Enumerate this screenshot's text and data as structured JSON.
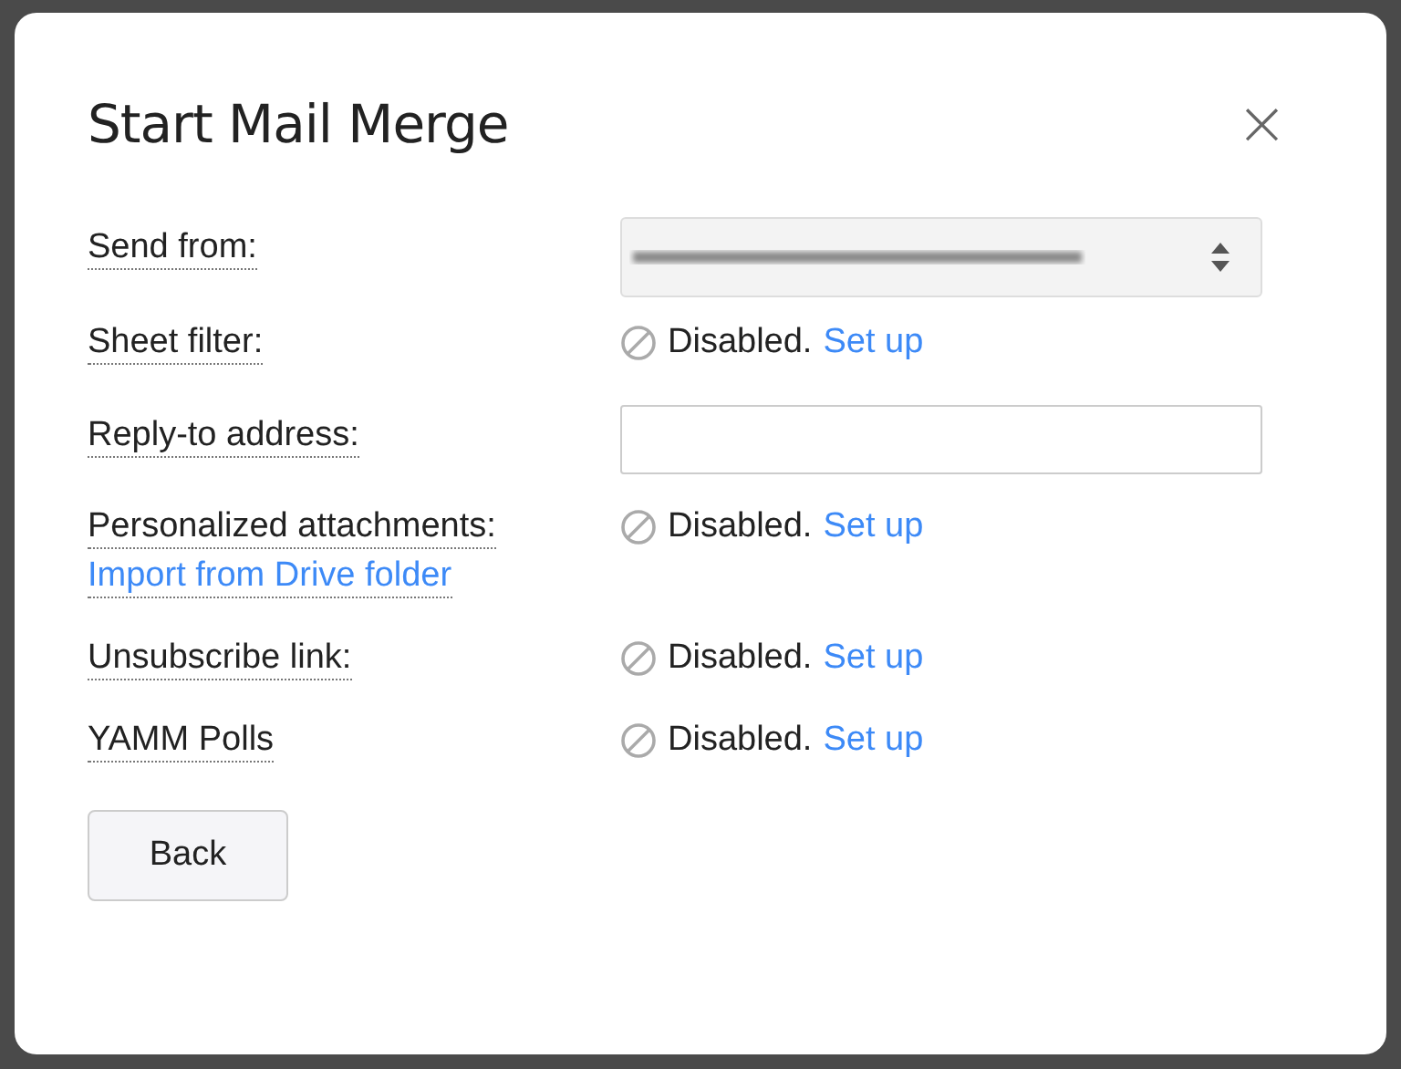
{
  "dialog": {
    "title": "Start Mail Merge",
    "close": "×"
  },
  "fields": [
    {
      "kind": "select",
      "label": "Send from:"
    },
    {
      "kind": "status",
      "label": "Sheet filter:",
      "status": "Disabled.",
      "link": "Set up"
    },
    {
      "kind": "input",
      "label": "Reply-to address:"
    },
    {
      "kind": "status",
      "label": "Personalized attachments:",
      "sublink": "Import from Drive folder",
      "status": "Disabled.",
      "link": "Set up"
    },
    {
      "kind": "status",
      "label": "Unsubscribe link:",
      "status": "Disabled.",
      "link": "Set up"
    },
    {
      "kind": "status",
      "label": "YAMM Polls",
      "status": "Disabled.",
      "link": "Set up"
    }
  ],
  "buttons": [
    "Back"
  ]
}
